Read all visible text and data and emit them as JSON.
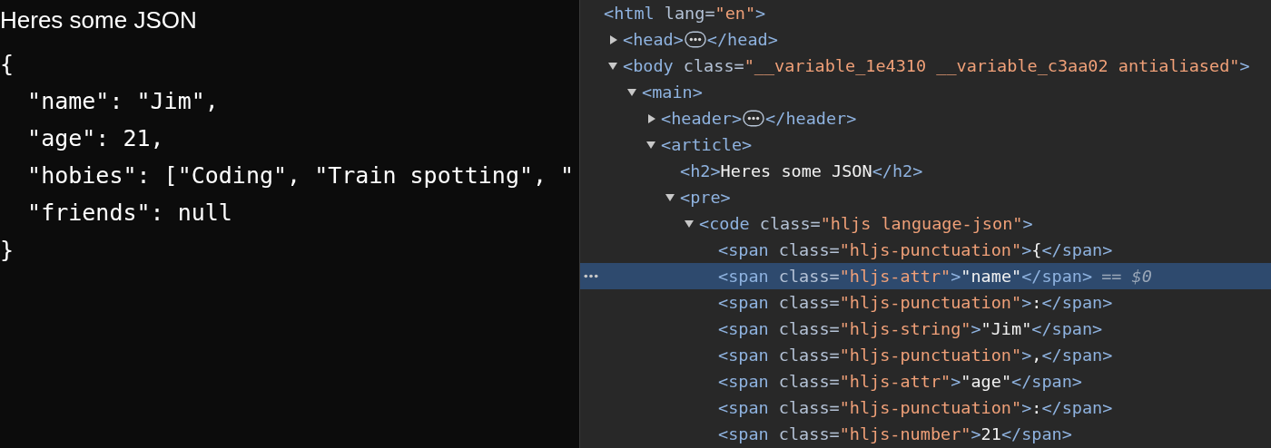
{
  "page": {
    "heading": "Heres some JSON",
    "code_lines": [
      "{",
      "  \"name\": \"Jim\",",
      "  \"age\": 21,",
      "  \"hobies\": [\"Coding\", \"Train spotting\", \"",
      "  \"friends\": null",
      "}"
    ]
  },
  "elements_tree": [
    {
      "selected": false,
      "tokens": [
        {
          "kind": "tag",
          "text": "<html "
        },
        {
          "kind": "attr",
          "text": "lang="
        },
        {
          "kind": "value",
          "text": "\"en\""
        },
        {
          "kind": "tag",
          "text": ">"
        }
      ],
      "children": [
        {
          "expanded": false,
          "selected": false,
          "tokens": [
            {
              "kind": "tag",
              "text": "<head>"
            },
            {
              "kind": "badge"
            },
            {
              "kind": "tag",
              "text": "</head>"
            }
          ]
        },
        {
          "expanded": true,
          "selected": false,
          "tokens": [
            {
              "kind": "tag",
              "text": "<body "
            },
            {
              "kind": "attr",
              "text": "class="
            },
            {
              "kind": "value",
              "text": "\"__variable_1e4310 __variable_c3aa02 antialiased\""
            },
            {
              "kind": "tag",
              "text": ">"
            }
          ],
          "children": [
            {
              "expanded": true,
              "selected": false,
              "tokens": [
                {
                  "kind": "tag",
                  "text": "<main>"
                }
              ],
              "children": [
                {
                  "expanded": false,
                  "selected": false,
                  "tokens": [
                    {
                      "kind": "tag",
                      "text": "<header>"
                    },
                    {
                      "kind": "badge"
                    },
                    {
                      "kind": "tag",
                      "text": "</header>"
                    }
                  ]
                },
                {
                  "expanded": true,
                  "selected": false,
                  "tokens": [
                    {
                      "kind": "tag",
                      "text": "<article>"
                    }
                  ],
                  "children": [
                    {
                      "selected": false,
                      "tokens": [
                        {
                          "kind": "tag",
                          "text": "<h2>"
                        },
                        {
                          "kind": "text",
                          "text": "Heres some JSON"
                        },
                        {
                          "kind": "tag",
                          "text": "</h2>"
                        }
                      ]
                    },
                    {
                      "expanded": true,
                      "selected": false,
                      "tokens": [
                        {
                          "kind": "tag",
                          "text": "<pre>"
                        }
                      ],
                      "children": [
                        {
                          "expanded": true,
                          "selected": false,
                          "tokens": [
                            {
                              "kind": "tag",
                              "text": "<code "
                            },
                            {
                              "kind": "attr",
                              "text": "class="
                            },
                            {
                              "kind": "value",
                              "text": "\"hljs language-json\""
                            },
                            {
                              "kind": "tag",
                              "text": ">"
                            }
                          ],
                          "children": [
                            {
                              "selected": false,
                              "tokens": [
                                {
                                  "kind": "tag",
                                  "text": "<span "
                                },
                                {
                                  "kind": "attr",
                                  "text": "class="
                                },
                                {
                                  "kind": "value",
                                  "text": "\"hljs-punctuation\""
                                },
                                {
                                  "kind": "tag",
                                  "text": ">"
                                },
                                {
                                  "kind": "text",
                                  "text": "{"
                                },
                                {
                                  "kind": "tag",
                                  "text": "</span>"
                                }
                              ]
                            },
                            {
                              "selected": true,
                              "tokens": [
                                {
                                  "kind": "tag",
                                  "text": "<span "
                                },
                                {
                                  "kind": "attr",
                                  "text": "class="
                                },
                                {
                                  "kind": "value",
                                  "text": "\"hljs-attr\""
                                },
                                {
                                  "kind": "tag",
                                  "text": ">"
                                },
                                {
                                  "kind": "text",
                                  "text": "\"name\""
                                },
                                {
                                  "kind": "tag",
                                  "text": "</span>"
                                },
                                {
                                  "kind": "hint",
                                  "text": "== $0"
                                }
                              ]
                            },
                            {
                              "selected": false,
                              "tokens": [
                                {
                                  "kind": "tag",
                                  "text": "<span "
                                },
                                {
                                  "kind": "attr",
                                  "text": "class="
                                },
                                {
                                  "kind": "value",
                                  "text": "\"hljs-punctuation\""
                                },
                                {
                                  "kind": "tag",
                                  "text": ">"
                                },
                                {
                                  "kind": "text",
                                  "text": ":"
                                },
                                {
                                  "kind": "tag",
                                  "text": "</span>"
                                }
                              ]
                            },
                            {
                              "selected": false,
                              "tokens": [
                                {
                                  "kind": "tag",
                                  "text": "<span "
                                },
                                {
                                  "kind": "attr",
                                  "text": "class="
                                },
                                {
                                  "kind": "value",
                                  "text": "\"hljs-string\""
                                },
                                {
                                  "kind": "tag",
                                  "text": ">"
                                },
                                {
                                  "kind": "text",
                                  "text": "\"Jim\""
                                },
                                {
                                  "kind": "tag",
                                  "text": "</span>"
                                }
                              ]
                            },
                            {
                              "selected": false,
                              "tokens": [
                                {
                                  "kind": "tag",
                                  "text": "<span "
                                },
                                {
                                  "kind": "attr",
                                  "text": "class="
                                },
                                {
                                  "kind": "value",
                                  "text": "\"hljs-punctuation\""
                                },
                                {
                                  "kind": "tag",
                                  "text": ">"
                                },
                                {
                                  "kind": "text",
                                  "text": ","
                                },
                                {
                                  "kind": "tag",
                                  "text": "</span>"
                                }
                              ]
                            },
                            {
                              "selected": false,
                              "tokens": [
                                {
                                  "kind": "tag",
                                  "text": "<span "
                                },
                                {
                                  "kind": "attr",
                                  "text": "class="
                                },
                                {
                                  "kind": "value",
                                  "text": "\"hljs-attr\""
                                },
                                {
                                  "kind": "tag",
                                  "text": ">"
                                },
                                {
                                  "kind": "text",
                                  "text": "\"age\""
                                },
                                {
                                  "kind": "tag",
                                  "text": "</span>"
                                }
                              ]
                            },
                            {
                              "selected": false,
                              "tokens": [
                                {
                                  "kind": "tag",
                                  "text": "<span "
                                },
                                {
                                  "kind": "attr",
                                  "text": "class="
                                },
                                {
                                  "kind": "value",
                                  "text": "\"hljs-punctuation\""
                                },
                                {
                                  "kind": "tag",
                                  "text": ">"
                                },
                                {
                                  "kind": "text",
                                  "text": ":"
                                },
                                {
                                  "kind": "tag",
                                  "text": "</span>"
                                }
                              ]
                            },
                            {
                              "selected": false,
                              "tokens": [
                                {
                                  "kind": "tag",
                                  "text": "<span "
                                },
                                {
                                  "kind": "attr",
                                  "text": "class="
                                },
                                {
                                  "kind": "value",
                                  "text": "\"hljs-number\""
                                },
                                {
                                  "kind": "tag",
                                  "text": ">"
                                },
                                {
                                  "kind": "text",
                                  "text": "21"
                                },
                                {
                                  "kind": "tag",
                                  "text": "</span>"
                                }
                              ]
                            }
                          ]
                        }
                      ]
                    }
                  ]
                }
              ]
            }
          ]
        }
      ]
    }
  ]
}
